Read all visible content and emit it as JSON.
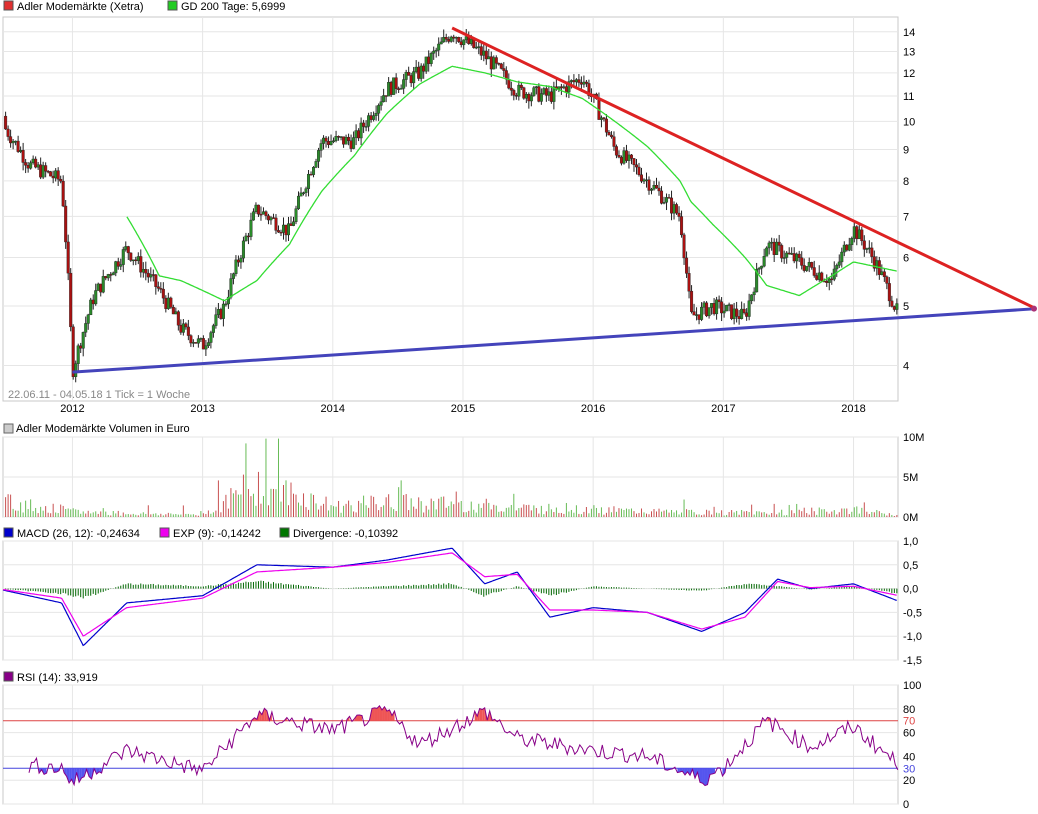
{
  "price": {
    "legend": [
      {
        "name": "Adler Modemärkte (Xetra)",
        "color": "#e03030"
      },
      {
        "name": "GD 200 Tage: 5,6999",
        "color": "#22cc22"
      }
    ],
    "info": "22.06.11 - 04.05.18   1 Tick = 1 Woche",
    "y_ticks": [
      "14",
      "13",
      "12",
      "11",
      "10",
      "9",
      "8",
      "7",
      "6",
      "5",
      "4"
    ],
    "x_ticks": [
      "2012",
      "2013",
      "2014",
      "2015",
      "2016",
      "2017",
      "2018"
    ],
    "colors": {
      "resistance": "#dd2222",
      "support": "#4444bb",
      "ma": "#33dd33",
      "up": "#2a8a2a",
      "down": "#aa1111"
    }
  },
  "volume": {
    "title": "Adler Modemärkte Volumen in Euro",
    "y_ticks": [
      "10M",
      "5M",
      "0M"
    ]
  },
  "macd": {
    "legend": [
      {
        "name": "MACD (26, 12): -0,24634",
        "color": "#0000cc"
      },
      {
        "name": "EXP (9): -0,14242",
        "color": "#ee00ee"
      },
      {
        "name": "Divergence: -0,10392",
        "color": "#007700"
      }
    ],
    "y_ticks": [
      "1,0",
      "0,5",
      "0,0",
      "-0,5",
      "-1,0",
      "-1,5"
    ]
  },
  "rsi": {
    "legend": [
      {
        "name": "RSI (14): 33,919",
        "color": "#880088"
      }
    ],
    "y_ticks": [
      "100",
      "80",
      "60",
      "40",
      "20",
      "0"
    ],
    "upper_label": "70",
    "lower_label": "30"
  },
  "chart_data": [
    {
      "type": "line",
      "title": "Adler Modemärkte (Xetra)",
      "y_scale": "log",
      "ylim": [
        3.5,
        14.8
      ],
      "x": [
        "2011-06",
        "2011-09",
        "2011-12",
        "2012-01",
        "2012-03",
        "2012-06",
        "2012-09",
        "2012-11",
        "2013-01",
        "2013-03",
        "2013-06",
        "2013-09",
        "2013-12",
        "2014-03",
        "2014-06",
        "2014-09",
        "2014-12",
        "2015-03",
        "2015-06",
        "2015-09",
        "2015-12",
        "2016-03",
        "2016-06",
        "2016-09",
        "2016-10",
        "2016-12",
        "2017-03",
        "2017-05",
        "2017-08",
        "2017-11",
        "2018-01",
        "2018-03",
        "2018-05"
      ],
      "series": [
        {
          "name": "Adler Modemärkte (Xetra)",
          "values": [
            10.2,
            8.5,
            8.0,
            3.9,
            5.2,
            6.2,
            5.3,
            4.6,
            4.3,
            5.0,
            7.2,
            6.6,
            9.3,
            9.3,
            11.3,
            12.0,
            14.0,
            12.8,
            11.2,
            11.0,
            11.8,
            9.0,
            8.0,
            7.0,
            4.8,
            5.0,
            4.8,
            6.3,
            5.9,
            5.5,
            6.7,
            5.9,
            4.9
          ]
        },
        {
          "name": "GD 200 Tage: 5,6999",
          "values": [
            null,
            null,
            null,
            null,
            null,
            7.0,
            5.6,
            5.5,
            5.3,
            5.1,
            5.5,
            6.3,
            7.7,
            8.8,
            10.3,
            11.5,
            12.3,
            12.0,
            11.6,
            11.4,
            10.9,
            10.0,
            9.1,
            8.0,
            7.4,
            6.8,
            6.0,
            5.4,
            5.2,
            5.6,
            5.9,
            5.8,
            5.7
          ]
        }
      ]
    },
    {
      "type": "bar",
      "title": "Adler Modemärkte Volumen in Euro",
      "ylim": [
        0,
        10000000
      ],
      "x": [
        "2011-06",
        "2012-01",
        "2012-06",
        "2013-01",
        "2013-06",
        "2014-01",
        "2014-06",
        "2015-01",
        "2015-06",
        "2016-01",
        "2016-06",
        "2017-01",
        "2017-06",
        "2018-01",
        "2018-05"
      ],
      "values": [
        4500000,
        1500000,
        1000000,
        700000,
        9200000,
        3000000,
        4000000,
        3500000,
        2500000,
        2000000,
        1500000,
        1200000,
        1200000,
        2000000,
        500000
      ]
    },
    {
      "type": "line",
      "title": "MACD",
      "ylim": [
        -1.5,
        1.0
      ],
      "x": [
        "2011-06",
        "2011-12",
        "2012-02",
        "2012-06",
        "2013-01",
        "2013-06",
        "2014-01",
        "2014-06",
        "2014-12",
        "2015-03",
        "2015-06",
        "2015-09",
        "2016-01",
        "2016-06",
        "2016-11",
        "2017-03",
        "2017-06",
        "2017-09",
        "2018-01",
        "2018-05"
      ],
      "series": [
        {
          "name": "MACD (26, 12): -0,24634",
          "values": [
            0.0,
            -0.3,
            -1.2,
            -0.3,
            -0.15,
            0.5,
            0.45,
            0.6,
            0.85,
            0.1,
            0.35,
            -0.6,
            -0.4,
            -0.5,
            -0.9,
            -0.5,
            0.2,
            0.0,
            0.1,
            -0.25
          ]
        },
        {
          "name": "EXP (9): -0,14242",
          "values": [
            0.0,
            -0.2,
            -1.0,
            -0.4,
            -0.2,
            0.35,
            0.45,
            0.55,
            0.75,
            0.25,
            0.3,
            -0.45,
            -0.45,
            -0.5,
            -0.85,
            -0.6,
            0.15,
            0.02,
            0.05,
            -0.14
          ]
        },
        {
          "name": "Divergence: -0,10392",
          "values": [
            0.0,
            -0.1,
            -0.2,
            0.1,
            0.05,
            0.15,
            0.0,
            0.05,
            0.1,
            -0.15,
            0.05,
            -0.15,
            0.05,
            0.0,
            -0.05,
            0.1,
            0.05,
            -0.02,
            0.05,
            -0.1
          ]
        }
      ]
    },
    {
      "type": "line",
      "title": "RSI (14)",
      "ylim": [
        0,
        100
      ],
      "x": [
        "2011-06",
        "2011-12",
        "2012-01",
        "2012-06",
        "2013-01",
        "2013-06",
        "2014-01",
        "2014-06",
        "2014-09",
        "2015-03",
        "2015-06",
        "2016-01",
        "2016-06",
        "2016-11",
        "2017-01",
        "2017-05",
        "2017-09",
        "2018-01",
        "2018-05"
      ],
      "series": [
        {
          "name": "RSI (14): 33,919",
          "values": [
            35,
            30,
            18,
            45,
            28,
            75,
            62,
            78,
            50,
            78,
            55,
            45,
            40,
            20,
            30,
            70,
            48,
            65,
            34
          ]
        }
      ],
      "lines": [
        70,
        30
      ]
    }
  ]
}
